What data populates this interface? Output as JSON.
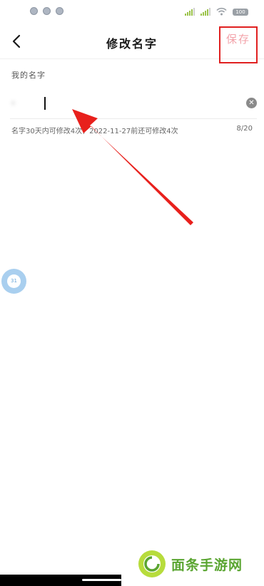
{
  "header": {
    "title": "修改名字",
    "save_label": "保存"
  },
  "form": {
    "field_label": "我的名字",
    "name_value": "·",
    "hint": "名字30天内可修改4次，2022-11-27前还可修改4次",
    "char_count": "8/20",
    "clear_symbol": "✕"
  },
  "status_bar": {
    "battery": "100"
  },
  "floating": {
    "label": "31"
  },
  "watermark": {
    "text": "面条手游网"
  },
  "colors": {
    "save_text": "#f3a3aa",
    "highlight_box": "#e02020",
    "arrow": "#e8201c",
    "watermark": "#5aa531"
  },
  "icons": {
    "back": "chevron-left-icon",
    "clear": "clear-circle-icon",
    "signal": "signal-icon",
    "wifi": "wifi-icon"
  }
}
